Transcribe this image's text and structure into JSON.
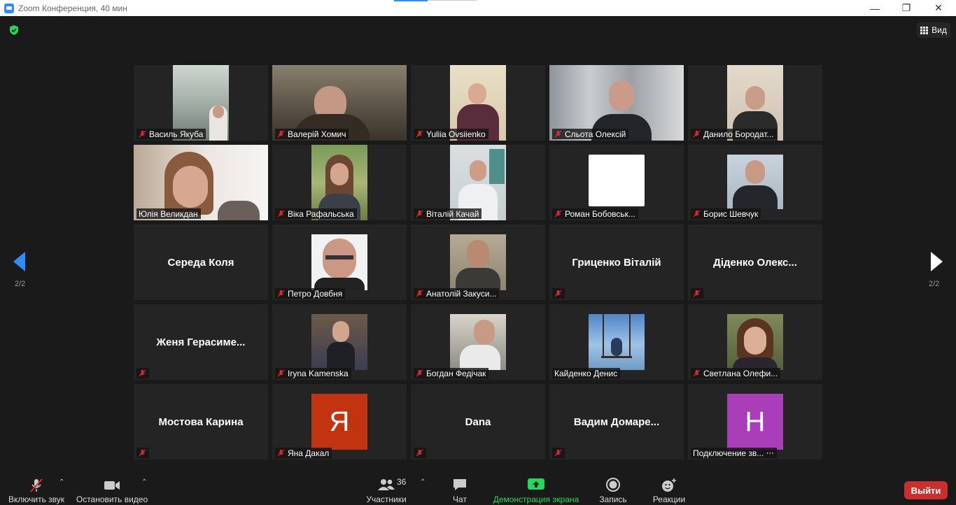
{
  "window": {
    "title": "Zoom Конференция, 40 мин",
    "minimize": "—",
    "restore": "❐",
    "close": "✕"
  },
  "header": {
    "view_label": "Вид",
    "shield_icon": "shield-check-icon",
    "shield_color": "#23d959"
  },
  "pagination": {
    "left_label": "2/2",
    "right_label": "2/2",
    "left_arrow_color": "#2d8cff",
    "right_arrow_color": "#ffffff"
  },
  "participants": [
    {
      "name": "Василь Якуба",
      "muted": true,
      "kind": "video"
    },
    {
      "name": "Валерій Хомич",
      "muted": true,
      "kind": "video"
    },
    {
      "name": "Yuliia Ovsiienko",
      "muted": true,
      "kind": "video"
    },
    {
      "name": "Сльота Олексій",
      "muted": true,
      "kind": "video"
    },
    {
      "name": "Данило Бородат...",
      "muted": true,
      "kind": "video"
    },
    {
      "name": "Юлія Великдан",
      "muted": false,
      "kind": "video"
    },
    {
      "name": "Віка Рафальська",
      "muted": true,
      "kind": "video"
    },
    {
      "name": "Віталій Качай",
      "muted": true,
      "kind": "video"
    },
    {
      "name": "Роман Бобовськ...",
      "muted": true,
      "kind": "video"
    },
    {
      "name": "Борис Шевчук",
      "muted": true,
      "kind": "video"
    },
    {
      "name": "Середа Коля",
      "muted": false,
      "kind": "name"
    },
    {
      "name": "Петро Довбня",
      "muted": true,
      "kind": "photo"
    },
    {
      "name": "Анатолій Закуси...",
      "muted": true,
      "kind": "photo"
    },
    {
      "name": "Гриценко Віталій",
      "muted": true,
      "kind": "name"
    },
    {
      "name": "Діденко  Олекс...",
      "muted": true,
      "kind": "name"
    },
    {
      "name": "Женя  Герасиме...",
      "muted": true,
      "kind": "name"
    },
    {
      "name": "Iryna Kamenska",
      "muted": true,
      "kind": "photo"
    },
    {
      "name": "Богдан Федічак",
      "muted": true,
      "kind": "photo"
    },
    {
      "name": "Кайденко Денис",
      "muted": false,
      "kind": "photo"
    },
    {
      "name": "Светлана Олефи...",
      "muted": true,
      "kind": "photo"
    },
    {
      "name": "Мостова Карина",
      "muted": true,
      "kind": "name"
    },
    {
      "name": "Яна Дакал",
      "muted": true,
      "kind": "avatar",
      "letter": "Я",
      "avatar_color": "#c2330f"
    },
    {
      "name": "Dana",
      "muted": true,
      "kind": "name"
    },
    {
      "name": "Вадим  Домаре...",
      "muted": true,
      "kind": "name"
    },
    {
      "name": "Подключение зв... ⋅⋅⋅",
      "muted": false,
      "kind": "avatar",
      "letter": "H",
      "avatar_color": "#a93eb8"
    }
  ],
  "toolbar": {
    "unmute_label": "Включить звук",
    "stop_video_label": "Остановить видео",
    "participants_label": "Участники",
    "participants_count": "36",
    "chat_label": "Чат",
    "share_label": "Демонстрация экрана",
    "share_color": "#23d959",
    "record_label": "Запись",
    "reactions_label": "Реакции",
    "leave_label": "Выйти",
    "leave_color": "#c9302c"
  }
}
